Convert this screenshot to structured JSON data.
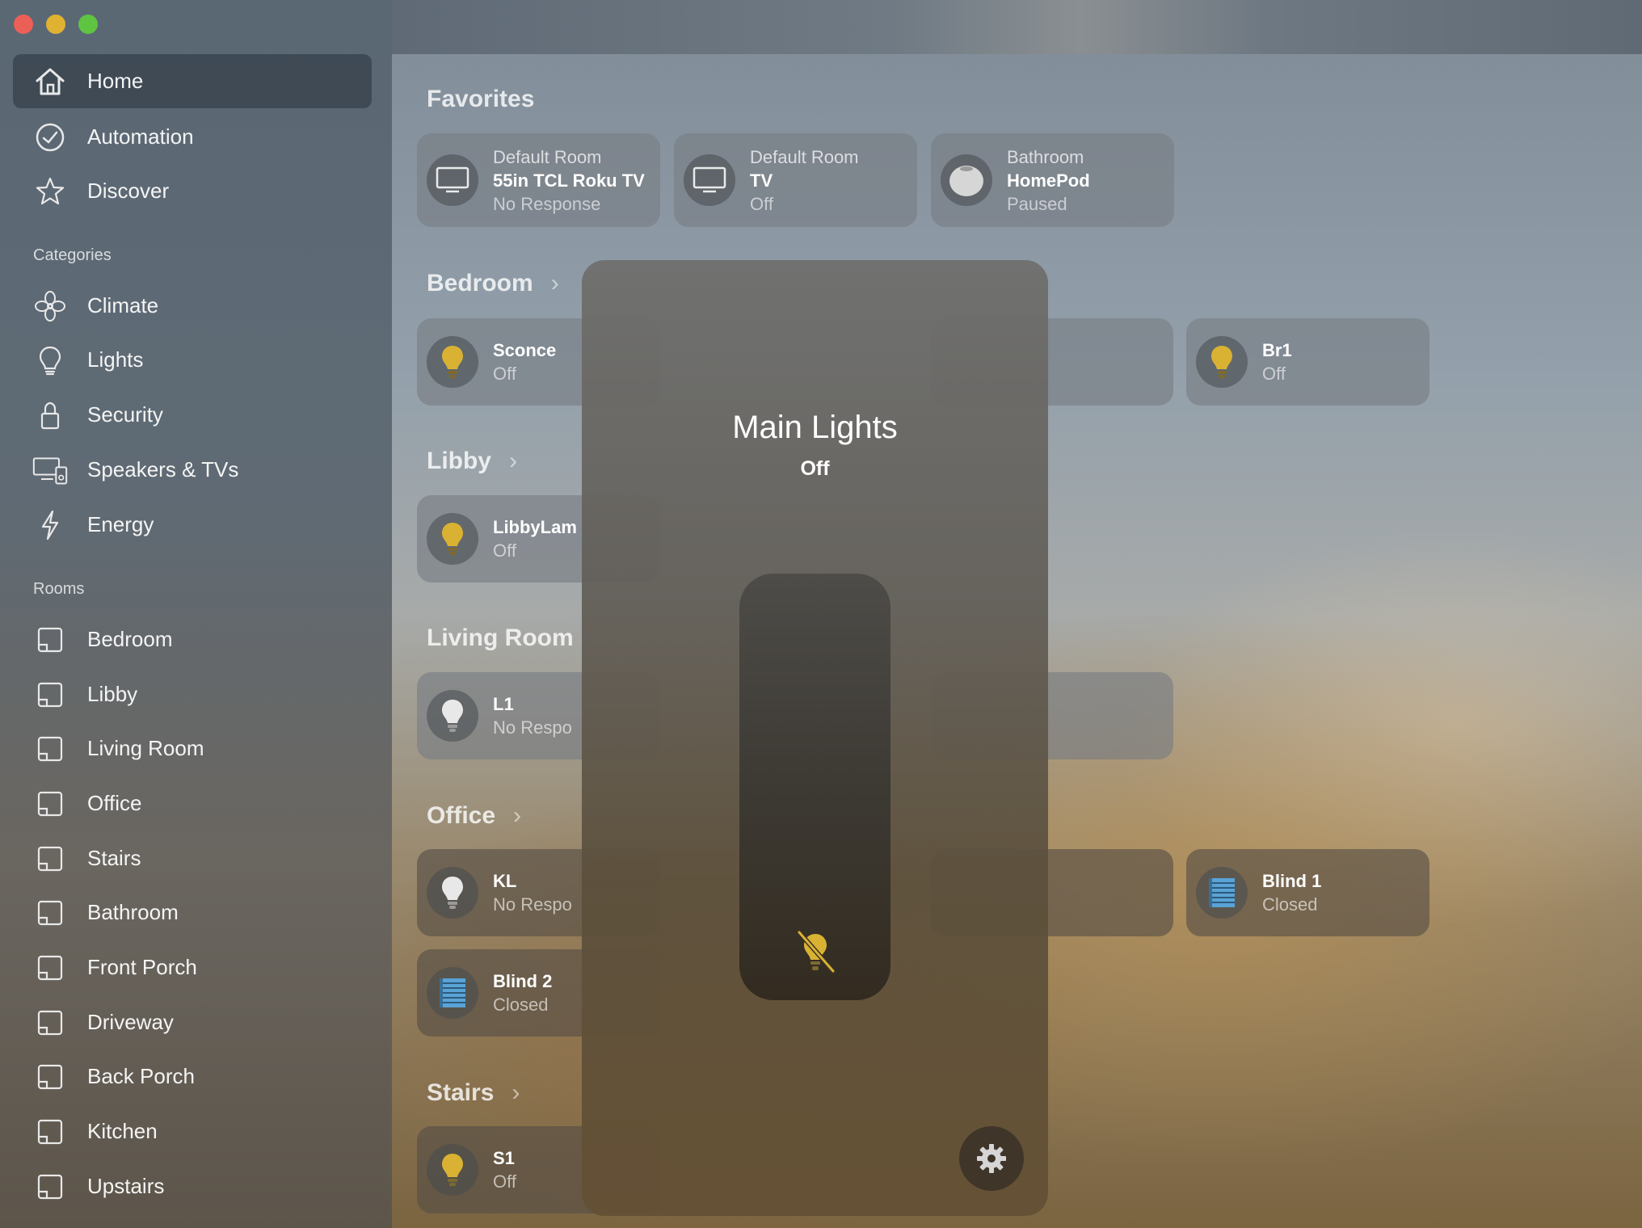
{
  "window": {
    "buttons": [
      "close",
      "minimize",
      "zoom"
    ]
  },
  "sidebar": {
    "top_items": [
      {
        "label": "Home",
        "icon": "house-icon",
        "selected": true
      },
      {
        "label": "Automation",
        "icon": "clock-check-icon"
      },
      {
        "label": "Discover",
        "icon": "star-icon"
      }
    ],
    "categories_header": "Categories",
    "categories": [
      {
        "label": "Climate",
        "icon": "fan-icon"
      },
      {
        "label": "Lights",
        "icon": "lightbulb-icon"
      },
      {
        "label": "Security",
        "icon": "lock-icon"
      },
      {
        "label": "Speakers & TVs",
        "icon": "speaker-tv-icon"
      },
      {
        "label": "Energy",
        "icon": "bolt-icon"
      }
    ],
    "rooms_header": "Rooms",
    "rooms": [
      {
        "label": "Bedroom"
      },
      {
        "label": "Libby"
      },
      {
        "label": "Living Room"
      },
      {
        "label": "Office"
      },
      {
        "label": "Stairs"
      },
      {
        "label": "Bathroom"
      },
      {
        "label": "Front Porch"
      },
      {
        "label": "Driveway"
      },
      {
        "label": "Back Porch"
      },
      {
        "label": "Kitchen"
      },
      {
        "label": "Upstairs"
      }
    ]
  },
  "main": {
    "favorites_title": "Favorites",
    "favorites": [
      {
        "room": "Default Room",
        "name": "55in TCL Roku TV",
        "status": "No Response",
        "icon": "tv-icon"
      },
      {
        "room": "Default Room",
        "name": "TV",
        "status": "Off",
        "icon": "tv-icon"
      },
      {
        "room": "Bathroom",
        "name": "HomePod",
        "status": "Paused",
        "icon": "homepod-icon"
      }
    ],
    "bedroom": {
      "title": "Bedroom",
      "tiles": [
        {
          "name": "Sconce",
          "status": "Off",
          "icon": "lightbulb-icon"
        },
        {
          "name": "Br1",
          "status": "Off",
          "icon": "lightbulb-icon"
        }
      ]
    },
    "libby": {
      "title": "Libby",
      "tiles": [
        {
          "name": "LibbyLam",
          "status": "Off",
          "icon": "lightbulb-icon"
        }
      ]
    },
    "living_room": {
      "title": "Living Room",
      "tiles": [
        {
          "name": "L1",
          "status": "No Respo",
          "icon": "lightbulb-icon"
        }
      ]
    },
    "office": {
      "title": "Office",
      "tiles": [
        {
          "name": "KL",
          "status": "No Respo",
          "icon": "lightbulb-icon"
        },
        {
          "name": "Blind 1",
          "status": "Closed",
          "icon": "blinds-icon"
        },
        {
          "name": "Blind 2",
          "status": "Closed",
          "icon": "blinds-icon"
        }
      ]
    },
    "stairs": {
      "title": "Stairs",
      "tiles": [
        {
          "name": "S1",
          "status": "Off",
          "icon": "lightbulb-icon"
        }
      ]
    }
  },
  "modal": {
    "title": "Main Lights",
    "status": "Off",
    "brightness_level": 0,
    "slider_icon": "lightbulb-off-icon",
    "settings_icon": "gear-icon"
  },
  "colors": {
    "bulb_on": "#d9b233",
    "bulb_off_white": "#e8e8e8",
    "blinds_blue": "#5aa3d6",
    "selected_nav": "#3a4550"
  }
}
